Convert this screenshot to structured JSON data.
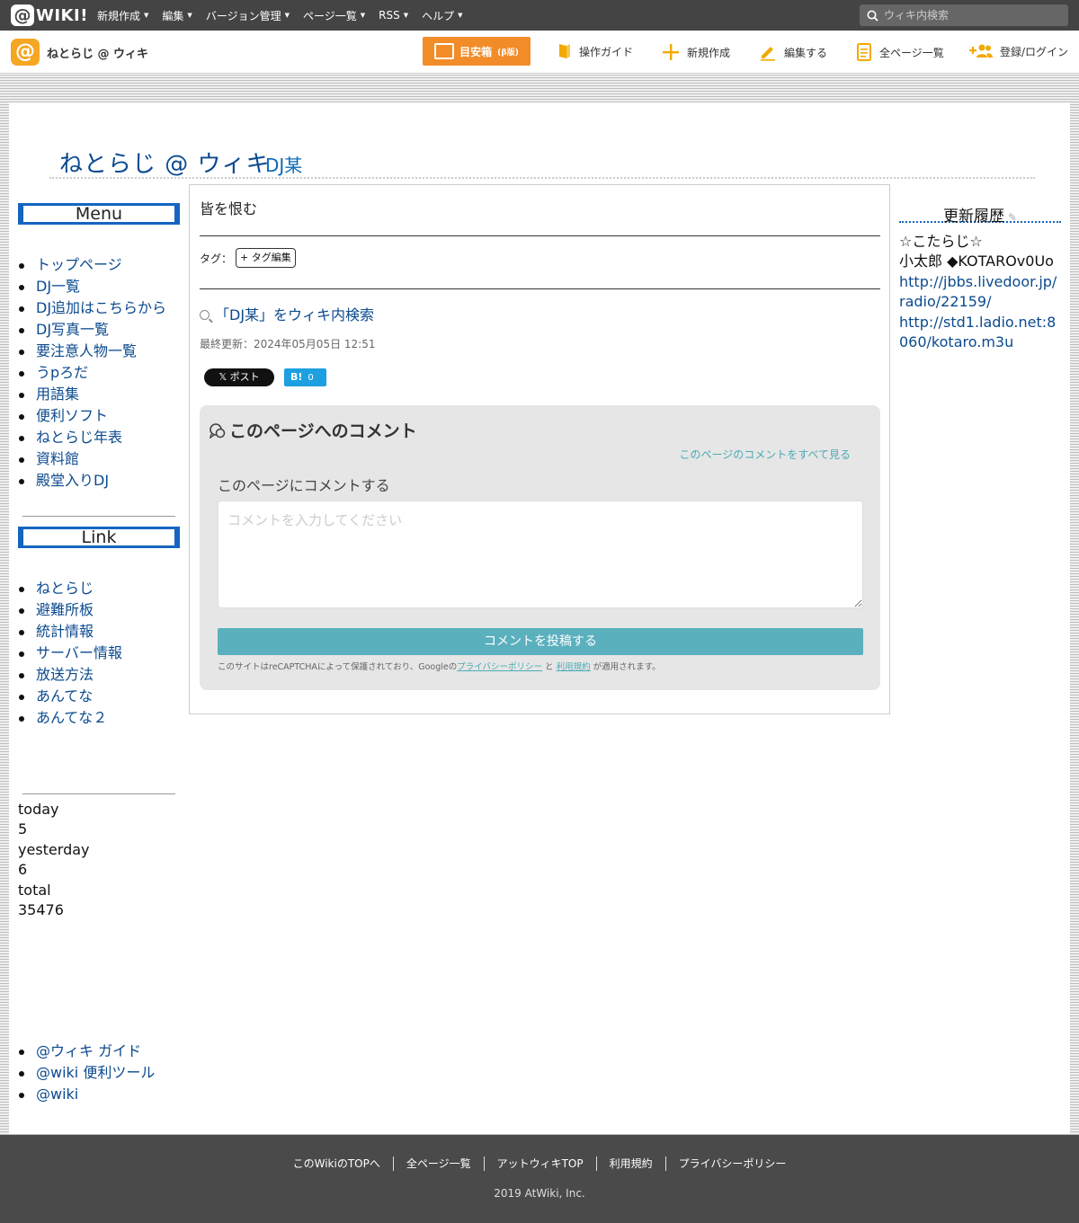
{
  "topbar": {
    "logo_at": "@",
    "logo_text": "WIKI!",
    "menu": [
      {
        "label": "新規作成"
      },
      {
        "label": "編集"
      },
      {
        "label": "バージョン管理"
      },
      {
        "label": "ページ一覧"
      },
      {
        "label": "RSS"
      },
      {
        "label": "ヘルプ"
      }
    ],
    "search_placeholder": "ウィキ内検索"
  },
  "toolbar": {
    "site_name": "ねとらじ @ ウィキ",
    "mokuyasu_label": "目安箱",
    "mokuyasu_sub": "(β版)",
    "items": [
      {
        "label": "操作ガイド",
        "icon": "book-icon"
      },
      {
        "label": "新規作成",
        "icon": "plus-icon"
      },
      {
        "label": "編集する",
        "icon": "pencil-icon"
      },
      {
        "label": "全ページ一覧",
        "icon": "page-list-icon"
      },
      {
        "label": "登録/ログイン",
        "icon": "add-user-icon"
      }
    ]
  },
  "header": {
    "wiki_title": "ねとらじ @ ウィキ",
    "page_name": "DJ某"
  },
  "sidebar": {
    "menu_title": "Menu",
    "menu_items": [
      "トップページ",
      "DJ一覧",
      "DJ追加はこちらから",
      "DJ写真一覧",
      "要注意人物一覧",
      "うpろだ",
      "用語集",
      "便利ソフト",
      "ねとらじ年表",
      "資料館",
      "殿堂入りDJ"
    ],
    "link_title": "Link",
    "link_items": [
      "ねとらじ",
      "避難所板",
      "統計情報",
      "サーバー情報",
      "放送方法",
      "あんてな",
      "あんてな２"
    ],
    "counter": {
      "today_label": "today",
      "today_value": "5",
      "yesterday_label": "yesterday",
      "yesterday_value": "6",
      "total_label": "total",
      "total_value": "35476"
    },
    "atwiki_links": [
      "@ウィキ ガイド",
      "@wiki 便利ツール",
      "@wiki"
    ]
  },
  "main": {
    "body_text": "皆を恨む",
    "tag_label": "タグ：",
    "tag_edit_button": "+ タグ編集",
    "search_link": "「DJ某」をウィキ内検索",
    "last_modified": "最終更新：2024年05月05日 12:51",
    "post_button": "𝕏 ポスト",
    "hatena_label": "B!",
    "hatena_count": "0"
  },
  "comments": {
    "title": "このページへのコメント",
    "view_all": "このページのコメントをすべて見る",
    "lead": "このページにコメントする",
    "placeholder": "コメントを入力してください",
    "submit": "コメントを投稿する",
    "note_prefix": "このサイトはreCAPTCHAによって保護されており、Googleの",
    "note_privacy": "プライバシーポリシー",
    "note_and": " と ",
    "note_terms": "利用規約",
    "note_suffix": " が適用されます。"
  },
  "rightbar": {
    "title": "更新履歴",
    "lines": [
      "☆こたらじ☆",
      "小太郎 ◆KOTAROv0Uo"
    ],
    "links": [
      "http://jbbs.livedoor.jp/radio/22159/",
      "http://std1.ladio.net:8060/kotaro.m3u"
    ]
  },
  "footer": {
    "links": [
      "このWikiのTOPへ",
      "全ページ一覧",
      "アットウィキTOP",
      "利用規約",
      "プライバシーポリシー"
    ],
    "copyright": "2019 AtWiki, Inc."
  }
}
